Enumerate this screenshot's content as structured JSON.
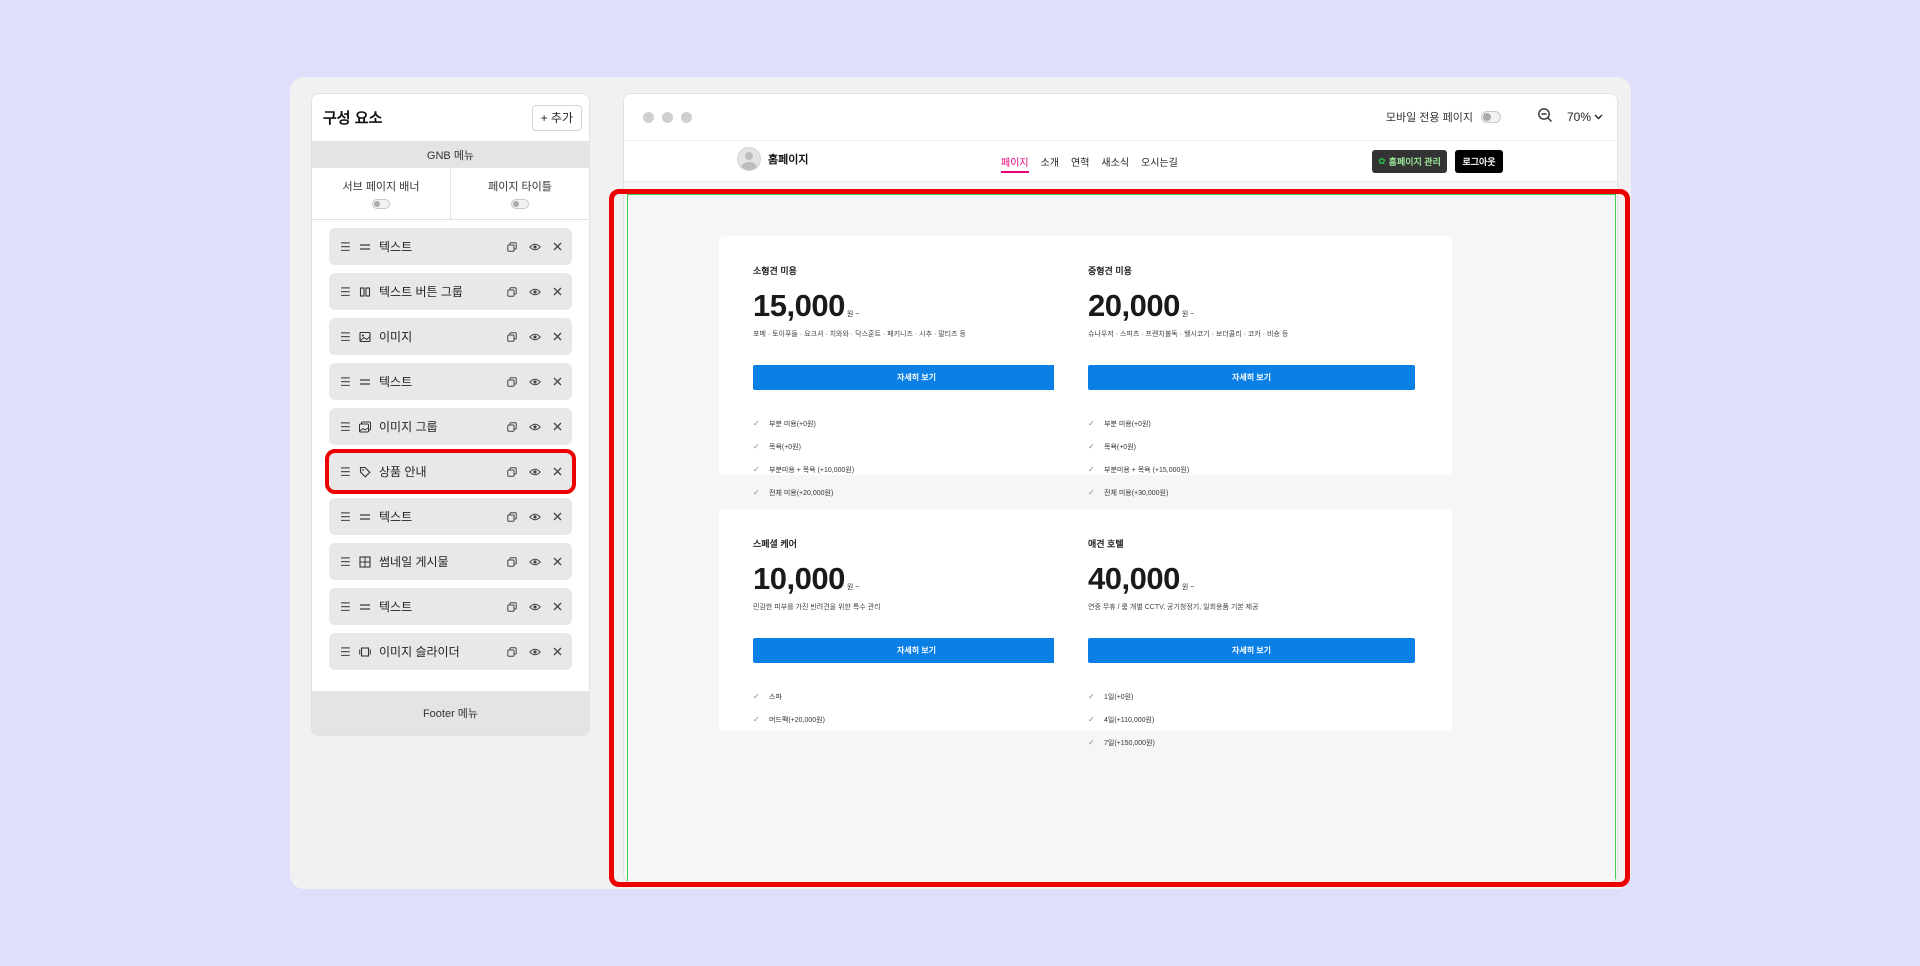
{
  "panel": {
    "title": "구성 요소",
    "add_label": "+ 추가",
    "gnb_label": "GNB 메뉴",
    "toggles": [
      {
        "label": "서브 페이지 배너"
      },
      {
        "label": "페이지 타이틀"
      }
    ],
    "items": [
      {
        "label": "텍스트",
        "icon": "text-icon"
      },
      {
        "label": "텍스트 버튼 그룹",
        "icon": "columns-icon"
      },
      {
        "label": "이미지",
        "icon": "image-icon"
      },
      {
        "label": "텍스트",
        "icon": "text-icon"
      },
      {
        "label": "이미지 그룹",
        "icon": "image-group-icon"
      },
      {
        "label": "상품 안내",
        "icon": "tag-icon",
        "selected": true
      },
      {
        "label": "텍스트",
        "icon": "text-icon"
      },
      {
        "label": "썸네일 게시물",
        "icon": "grid-icon"
      },
      {
        "label": "텍스트",
        "icon": "text-icon"
      },
      {
        "label": "이미지 슬라이더",
        "icon": "slider-icon"
      }
    ],
    "footer_label": "Footer 메뉴"
  },
  "toolbar": {
    "mobile_label": "모바일 전용 페이지",
    "zoom": "70%"
  },
  "site": {
    "logo_text": "홈페이지",
    "nav": [
      "페이지",
      "소개",
      "연혁",
      "새소식",
      "오시는길"
    ],
    "active_nav": 0,
    "manage_label": "홈페이지 관리",
    "logout_label": "로그아웃"
  },
  "cards": [
    {
      "title": "소형견 미용",
      "price": "15,000",
      "unit": "원 ~",
      "desc": "포메 · 토이푸들 · 요크셔 · 치와와 · 닥스훈트 · 페키니즈 · 시추 · 말티즈 등",
      "button": "자세히 보기",
      "features": [
        "부분 미용(+0원)",
        "목욕(+0원)",
        "부분미용 + 목욕 (+10,000원)",
        "전체 미용(+20,000원)"
      ]
    },
    {
      "title": "중형견 미용",
      "price": "20,000",
      "unit": "원 ~",
      "desc": "슈나우저 · 스피츠 · 프렌치불독 · 웰시코기 · 보더콜리 · 코카 · 비숑 등",
      "button": "자세히 보기",
      "features": [
        "부분 미용(+0원)",
        "목욕(+0원)",
        "부분미용 + 목욕 (+15,000원)",
        "전체 미용(+30,000원)"
      ]
    },
    {
      "title": "스페셜 케어",
      "price": "10,000",
      "unit": "원 ~",
      "desc": "민감한 피부를 가진 반려견을 위한 특수 관리",
      "button": "자세히 보기",
      "features": [
        "스파",
        "머드팩(+20,000원)"
      ]
    },
    {
      "title": "애견 호텔",
      "price": "40,000",
      "unit": "원 ~",
      "desc": "연중 무휴 / 룸 개별 CCTV, 공기청정기, 일회용품 기본 제공",
      "button": "자세히 보기",
      "features": [
        "1일(+0원)",
        "4일(+110,000원)",
        "7일(+150,000원)"
      ]
    }
  ],
  "colors": {
    "accent_blue": "#0a7fe6",
    "nav_active": "#e6007e",
    "highlight_red": "#ec0000",
    "outline_green": "#3fcf56"
  }
}
